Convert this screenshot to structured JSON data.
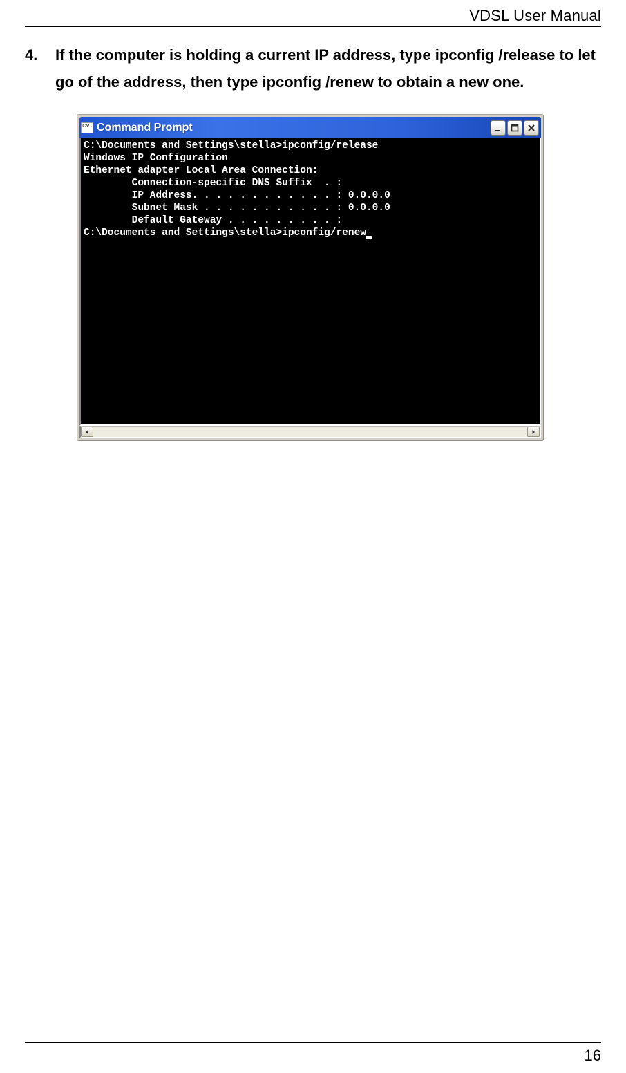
{
  "header": {
    "title": "VDSL User Manual"
  },
  "instruction": {
    "number": "4.",
    "text": "If the computer is holding a current IP address, type ipconfig /release to let go of the address, then type ipconfig /renew to obtain a new one."
  },
  "command_prompt": {
    "title": "Command Prompt",
    "icon_label": "cv.",
    "lines": [
      "",
      "C:\\Documents and Settings\\stella>ipconfig/release",
      "",
      "Windows IP Configuration",
      "",
      "",
      "Ethernet adapter Local Area Connection:",
      "",
      "        Connection-specific DNS Suffix  . :",
      "        IP Address. . . . . . . . . . . . : 0.0.0.0",
      "        Subnet Mask . . . . . . . . . . . : 0.0.0.0",
      "        Default Gateway . . . . . . . . . :",
      "",
      "C:\\Documents and Settings\\stella>ipconfig/renew"
    ]
  },
  "page_number": "16"
}
